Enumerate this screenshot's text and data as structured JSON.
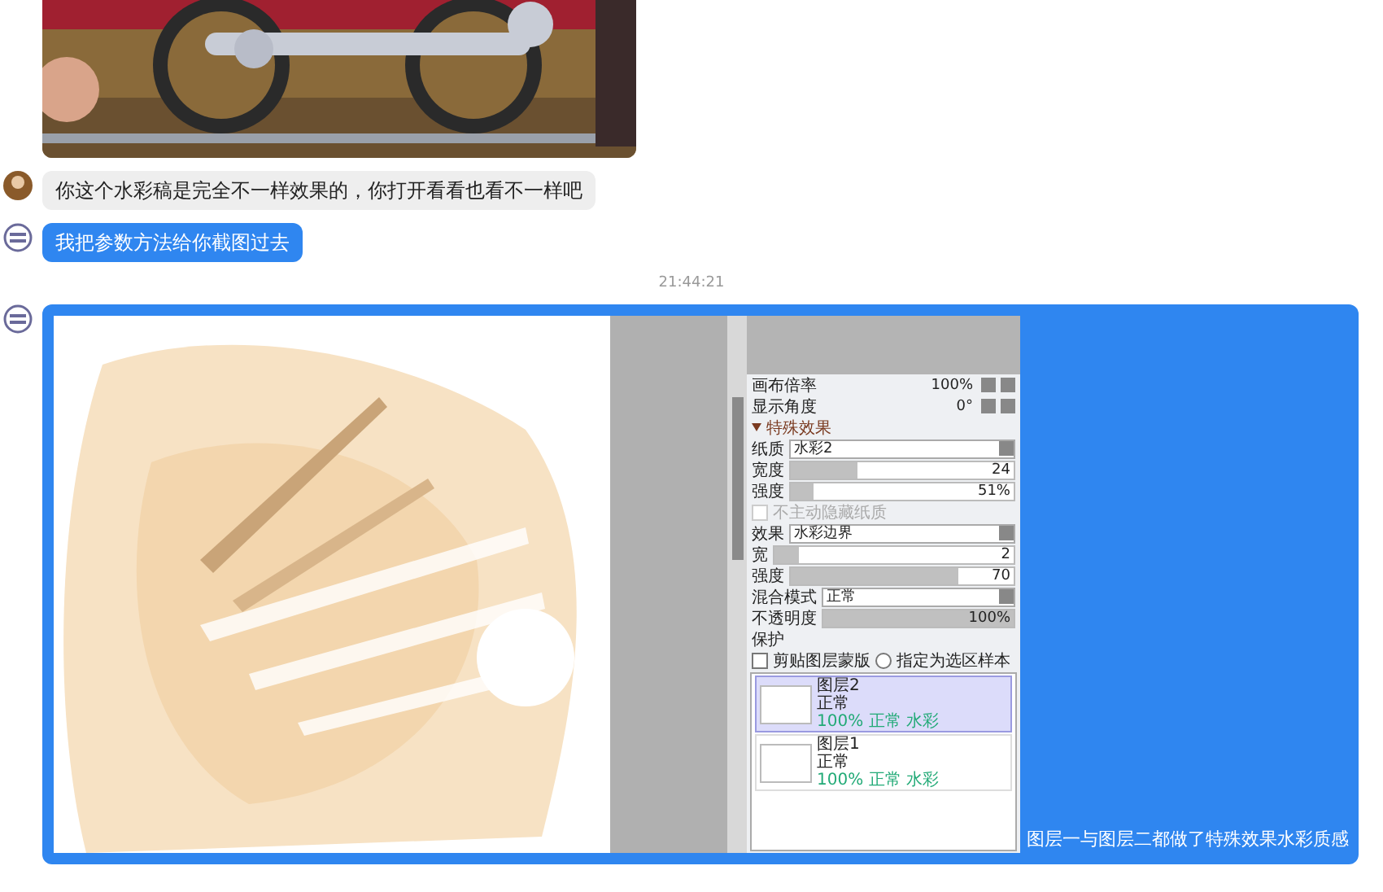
{
  "chat": [
    {
      "kind": "picture"
    },
    {
      "kind": "text",
      "avatar": {
        "kind": "person"
      },
      "sent": false,
      "text": "你这个水彩稿是完全不一样效果的，你打开看看也看不一样吧"
    },
    {
      "kind": "text",
      "avatar": {
        "kind": "logo"
      },
      "sent": true,
      "text": "我把参数方法给你截图过去"
    },
    {
      "kind": "time",
      "text": "21:44:21"
    },
    {
      "kind": "screenshot",
      "avatar": {
        "kind": "logo"
      },
      "caption": "图层一与图层二都做了特殊效果水彩质感"
    }
  ],
  "app": {
    "nav": [
      {
        "label": "画布倍率",
        "value": "100%"
      },
      {
        "label": "显示角度",
        "value": "0°"
      }
    ],
    "effects_title": "特殊效果",
    "paper": {
      "label": "纸质",
      "value": "水彩2"
    },
    "paper_sliders": [
      {
        "label": "宽度",
        "value": "24",
        "level": 0.3
      },
      {
        "label": "强度",
        "value": "51%",
        "level": 0.1
      }
    ],
    "paper_check": {
      "label": "不主动隐藏纸质",
      "checked": false,
      "disabled": true
    },
    "effect": {
      "label": "效果",
      "value": "水彩边界"
    },
    "effect_sliders": [
      {
        "label": "宽",
        "value": "2",
        "level": 0.1
      },
      {
        "label": "强度",
        "value": "70",
        "level": 0.75
      }
    ],
    "blend": {
      "label": "混合模式",
      "value": "正常"
    },
    "opacity": {
      "label": "不透明度",
      "value": "100%",
      "level": 1
    },
    "protect_label": "保护",
    "options": [
      {
        "kind": "checkbox",
        "label": "剪贴图层蒙版",
        "checked": false
      },
      {
        "kind": "radio",
        "label": "指定为选区样本",
        "checked": false
      }
    ],
    "layers": [
      {
        "name": "图层2",
        "mode": "正常",
        "info": "100% 正常 水彩",
        "selected": true
      },
      {
        "name": "图层1",
        "mode": "正常",
        "info": "100% 正常 水彩",
        "selected": false
      }
    ]
  }
}
